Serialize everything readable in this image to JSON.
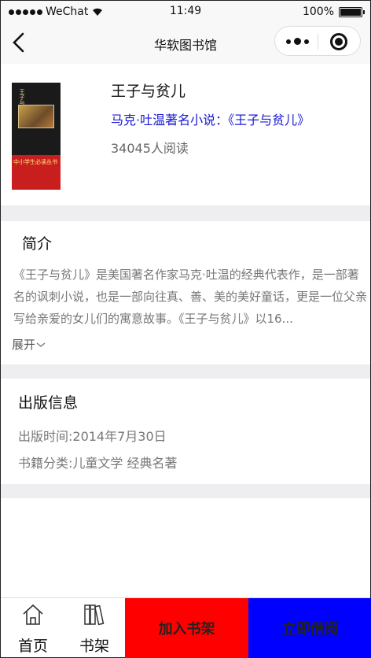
{
  "status": {
    "carrier": "WeChat",
    "time": "11:49",
    "battery": "100%"
  },
  "nav": {
    "title": "华软图书馆"
  },
  "book": {
    "name": "王子与贫儿",
    "subtitle": "马克·吐温著名小说：《王子与贫儿》",
    "reads": "34045人阅读",
    "cover_title": "王子与贫儿",
    "cover_series": "中小学生必读丛书"
  },
  "intro": {
    "heading": "简介",
    "text": "《王子与贫儿》是美国著名作家马克·吐温的经典代表作，是一部著名的讽刺小说，也是一部向往真、善、美的美好童话，更是一位父亲写给亲爱的女儿们的寓意故事。《王子与贫儿》以16...",
    "expand": "展开"
  },
  "publish": {
    "heading": "出版信息",
    "date": "出版时间:2014年7月30日",
    "category": "书籍分类:儿童文学 经典名著"
  },
  "tabbar": {
    "home": "首页",
    "shelf": "书架",
    "add_shelf": "加入书架",
    "borrow": "立即借阅"
  },
  "colors": {
    "add_shelf_bg": "#ff0000",
    "borrow_bg": "#0000ff",
    "subtitle": "#1a1ad6"
  }
}
